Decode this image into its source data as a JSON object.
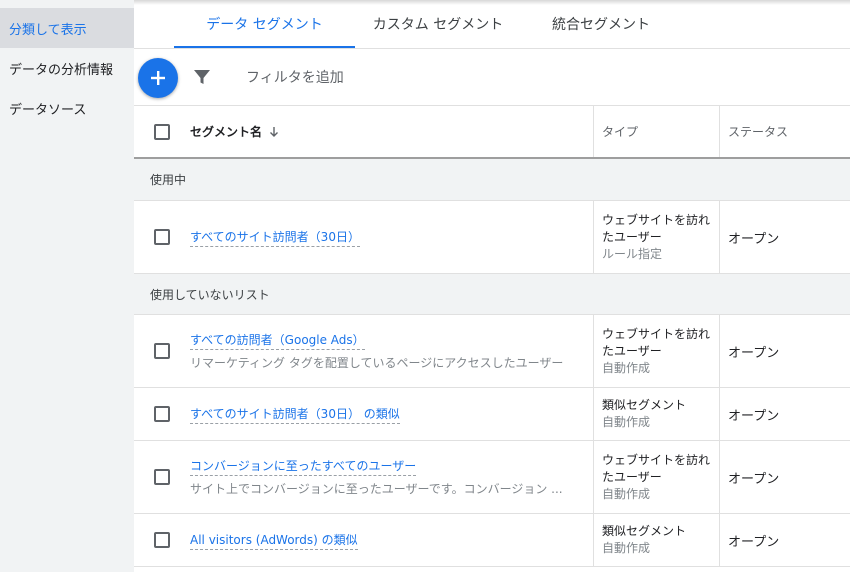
{
  "sidebar": {
    "items": [
      {
        "label": "分類して表示",
        "active": true
      },
      {
        "label": "データの分析情報",
        "active": false
      },
      {
        "label": "データソース",
        "active": false
      }
    ]
  },
  "tabs": [
    {
      "label": "データ セグメント",
      "active": true
    },
    {
      "label": "カスタム セグメント",
      "active": false
    },
    {
      "label": "統合セグメント",
      "active": false
    }
  ],
  "toolbar": {
    "add_icon": "plus-icon",
    "filter_icon": "filter-icon",
    "filter_label": "フィルタを追加"
  },
  "table": {
    "headers": {
      "name": "セグメント名",
      "type": "タイプ",
      "status": "ステータス"
    },
    "groups": [
      {
        "label": "使用中",
        "rows": [
          {
            "name": "すべてのサイト訪問者（30日）",
            "desc": "",
            "type": "ウェブサイトを訪れたユーザー",
            "type_sub": "ルール指定",
            "status": "オープン"
          }
        ]
      },
      {
        "label": "使用していないリスト",
        "rows": [
          {
            "name": "すべての訪問者（Google Ads）",
            "desc": "リマーケティング タグを配置しているページにアクセスしたユーザー",
            "type": "ウェブサイトを訪れたユーザー",
            "type_sub": "自動作成",
            "status": "オープン"
          },
          {
            "name": "すべてのサイト訪問者（30日） の類似",
            "desc": "",
            "type": "類似セグメント",
            "type_sub": "自動作成",
            "status": "オープン"
          },
          {
            "name": "コンバージョンに至ったすべてのユーザー",
            "desc": "サイト上でコンバージョンに至ったユーザーです。コンバージョン ...",
            "type": "ウェブサイトを訪れたユーザー",
            "type_sub": "自動作成",
            "status": "オープン"
          },
          {
            "name": "All visitors (AdWords) の類似",
            "desc": "",
            "type": "類似セグメント",
            "type_sub": "自動作成",
            "status": "オープン"
          }
        ]
      }
    ]
  },
  "colors": {
    "accent": "#1a73e8",
    "sidebar_bg": "#f1f3f4",
    "sidebar_active_bg": "#dadce0"
  }
}
